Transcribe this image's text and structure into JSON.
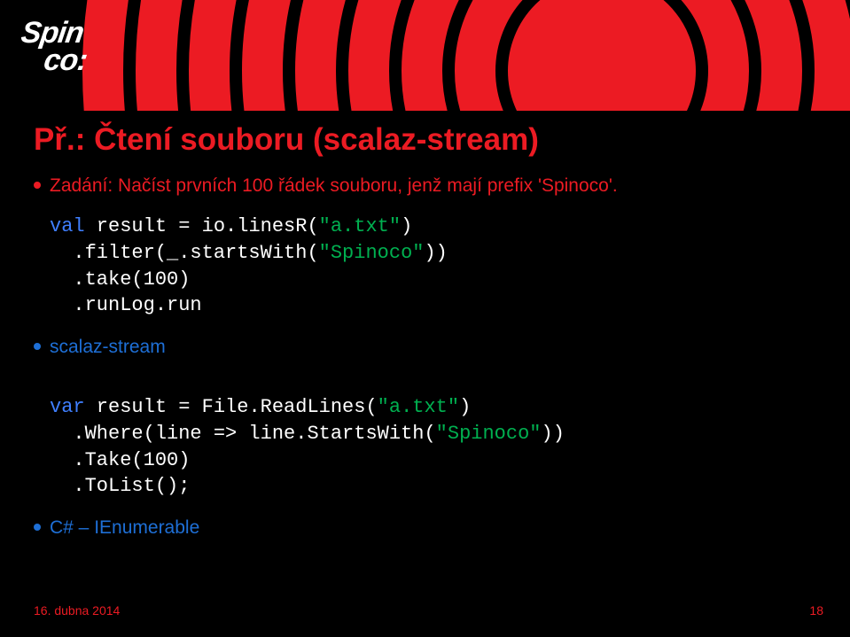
{
  "logo_line1": "Spin",
  "logo_line2": "co:",
  "title": "Př.: Čtení souboru (scalaz-stream)",
  "subtitle": "Zadání: Načíst prvních 100 řádek souboru, jenž mají prefix 'Spinoco'.",
  "code1": {
    "kw1": "val",
    "l1_rest": " result = io.linesR(",
    "str1": "\"a.txt\"",
    "l1_end": ")",
    "l2a": "  .filter(_.startsWith(",
    "str2": "\"Spinoco\"",
    "l2b": "))",
    "l3": "  .take(100)",
    "l4": "  .runLog.run"
  },
  "bullet2": "scalaz-stream",
  "code2": {
    "kw1": "var",
    "l1_rest": " result = File.ReadLines(",
    "str1": "\"a.txt\"",
    "l1_end": ")",
    "l2a": "  .Where(line => line.StartsWith(",
    "str2": "\"Spinoco\"",
    "l2b": "))",
    "l3": "  .Take(100)",
    "l4": "  .ToList();"
  },
  "bullet3": "C# – IEnumerable",
  "footer_date": "16. dubna 2014",
  "footer_page": "18"
}
